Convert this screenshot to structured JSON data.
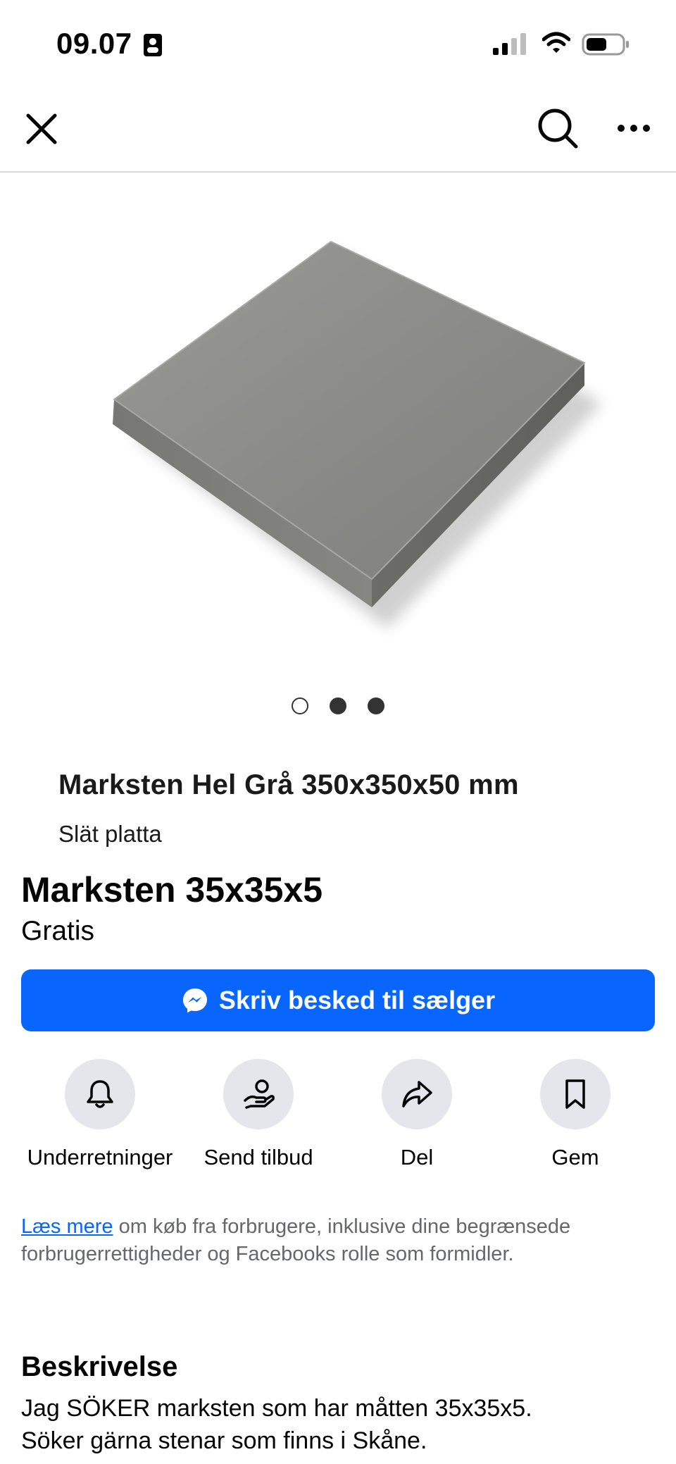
{
  "status_bar": {
    "time": "09.07",
    "icons": [
      "contact-card-icon",
      "cellular-signal-icon",
      "wifi-icon",
      "battery-icon"
    ]
  },
  "nav": {
    "icons": [
      "close-icon",
      "search-icon",
      "more-icon"
    ]
  },
  "photo": {
    "caption_title": "Marksten Hel Grå 350x350x50 mm",
    "caption_subtitle": "Slät platta",
    "page_count": 3,
    "current_page": 1
  },
  "listing": {
    "title": "Marksten 35x35x5",
    "price": "Gratis"
  },
  "message_button": {
    "label": "Skriv besked til sælger",
    "icon": "messenger-icon",
    "color": "#0866ff"
  },
  "actions": [
    {
      "label": "Underretninger",
      "icon": "bell-icon"
    },
    {
      "label": "Send tilbud",
      "icon": "offer-hand-icon"
    },
    {
      "label": "Del",
      "icon": "share-icon"
    },
    {
      "label": "Gem",
      "icon": "bookmark-icon"
    }
  ],
  "legal": {
    "link_text": "Læs mere",
    "text": " om køb fra forbrugere, inklusive dine begrænsede forbrugerrettigheder og Facebooks rolle som formidler."
  },
  "description": {
    "heading": "Beskrivelse",
    "lines": [
      "Jag SÖKER marksten som har måtten 35x35x5.",
      "Söker gärna stenar som finns i Skåne."
    ]
  }
}
